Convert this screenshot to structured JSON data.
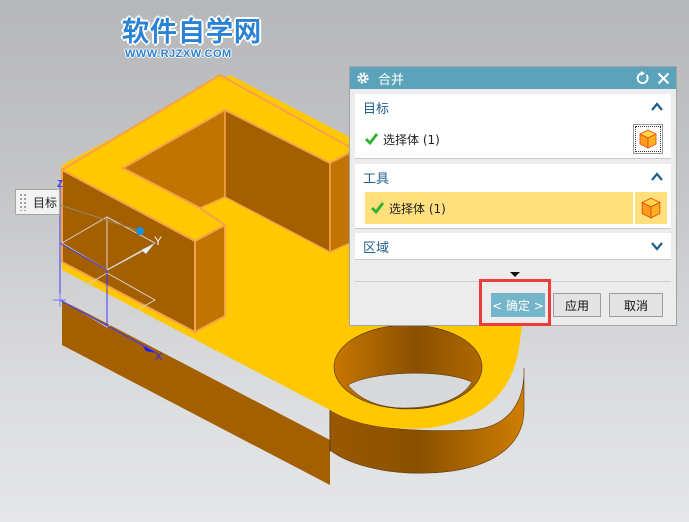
{
  "watermark": {
    "title": "软件自学网",
    "url": "WWW.RJZXW.COM"
  },
  "viewport": {
    "tag_label": "目标",
    "axis_labels": {
      "x": "X",
      "y": "Y",
      "z": "Z"
    },
    "model_colors": {
      "top": "#ffc800",
      "side_dark": "#a35f00",
      "side_mid": "#c27400",
      "edge": "#f5a24a"
    }
  },
  "dialog": {
    "title": "合并",
    "icons": [
      "gear-icon",
      "reset-icon",
      "close-icon"
    ],
    "accent": "#5aa3bb",
    "sections": [
      {
        "label": "目标",
        "expanded": true,
        "row_text": "选择体 (1)"
      },
      {
        "label": "工具",
        "expanded": true,
        "row_text": "选择体 (1)"
      },
      {
        "label": "区域",
        "expanded": false
      }
    ],
    "buttons": {
      "ok": "< 确定 >",
      "apply": "应用",
      "cancel": "取消"
    }
  }
}
